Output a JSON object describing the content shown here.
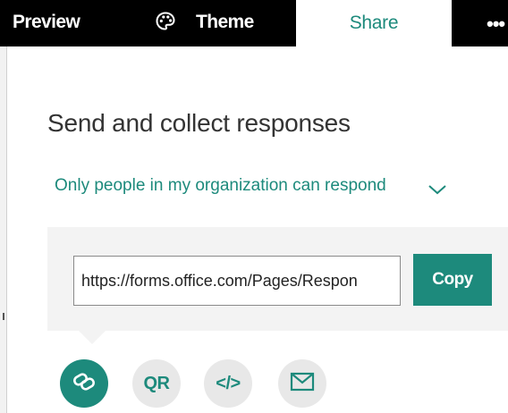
{
  "topbar": {
    "preview_label": "Preview",
    "theme_label": "Theme",
    "share_label": "Share",
    "more_label": "•••"
  },
  "share": {
    "heading": "Send and collect responses",
    "audience": "Only people in my organization can respond",
    "url_value": "https://forms.office.com/Pages/Respon",
    "copy_label": "Copy",
    "options": {
      "qr_label": "QR",
      "embed_label": "</>"
    }
  },
  "colors": {
    "accent": "#1d8a7c",
    "topbar_bg": "#000000",
    "panel_bg": "#f3f3f3",
    "option_bg": "#e8e8e8"
  },
  "icons": [
    "palette-icon",
    "chevron-down-icon",
    "link-icon",
    "email-icon"
  ]
}
